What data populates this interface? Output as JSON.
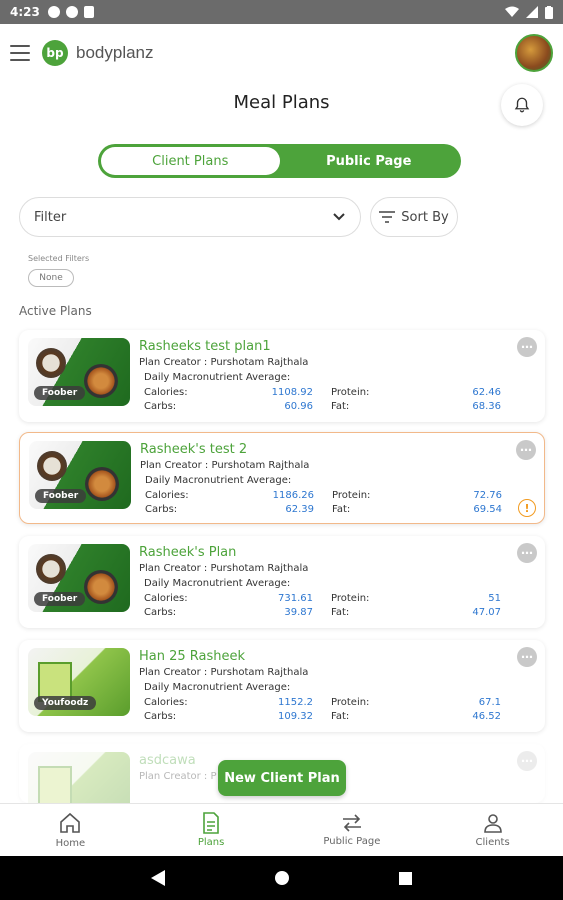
{
  "status_bar": {
    "time": "4:23"
  },
  "app": {
    "brand": "bodyplanz",
    "logo_mark": "bp"
  },
  "page": {
    "title": "Meal Plans"
  },
  "toggle": {
    "client_label": "Client Plans",
    "public_label": "Public Page"
  },
  "filters": {
    "filter_label": "Filter",
    "sort_label": "Sort By",
    "selected_label": "Selected Filters",
    "selected_value": "None"
  },
  "section": {
    "title": "Active Plans"
  },
  "labels": {
    "daily_macro": "Daily Macronutrient Average:",
    "calories": "Calories:",
    "carbs": "Carbs:",
    "protein": "Protein:",
    "fat": "Fat:"
  },
  "plans": [
    {
      "name": "Rasheeks test plan1",
      "creator": "Plan Creator : Purshotam Rajthala",
      "source": "Foober",
      "calories": "1108.92",
      "carbs": "60.96",
      "protein": "62.46",
      "fat": "68.36"
    },
    {
      "name": "Rasheek's test 2",
      "creator": "Plan Creator : Purshotam Rajthala",
      "source": "Foober",
      "calories": "1186.26",
      "carbs": "62.39",
      "protein": "72.76",
      "fat": "69.54"
    },
    {
      "name": "Rasheek's Plan",
      "creator": "Plan Creator : Purshotam Rajthala",
      "source": "Foober",
      "calories": "731.61",
      "carbs": "39.87",
      "protein": "51",
      "fat": "47.07"
    },
    {
      "name": "Han 25 Rasheek",
      "creator": "Plan Creator : Purshotam Rajthala",
      "source": "Youfoodz",
      "calories": "1152.2",
      "carbs": "109.32",
      "protein": "67.1",
      "fat": "46.52"
    },
    {
      "name": "asdcawa",
      "creator": "Plan Creator : P"
    }
  ],
  "fab": {
    "label": "New Client Plan"
  },
  "nav": {
    "home": "Home",
    "plans": "Plans",
    "public": "Public Page",
    "clients": "Clients"
  },
  "colors": {
    "brand_green": "#4da33b",
    "value_blue": "#2e77d0",
    "warning_orange": "#f29b20"
  }
}
